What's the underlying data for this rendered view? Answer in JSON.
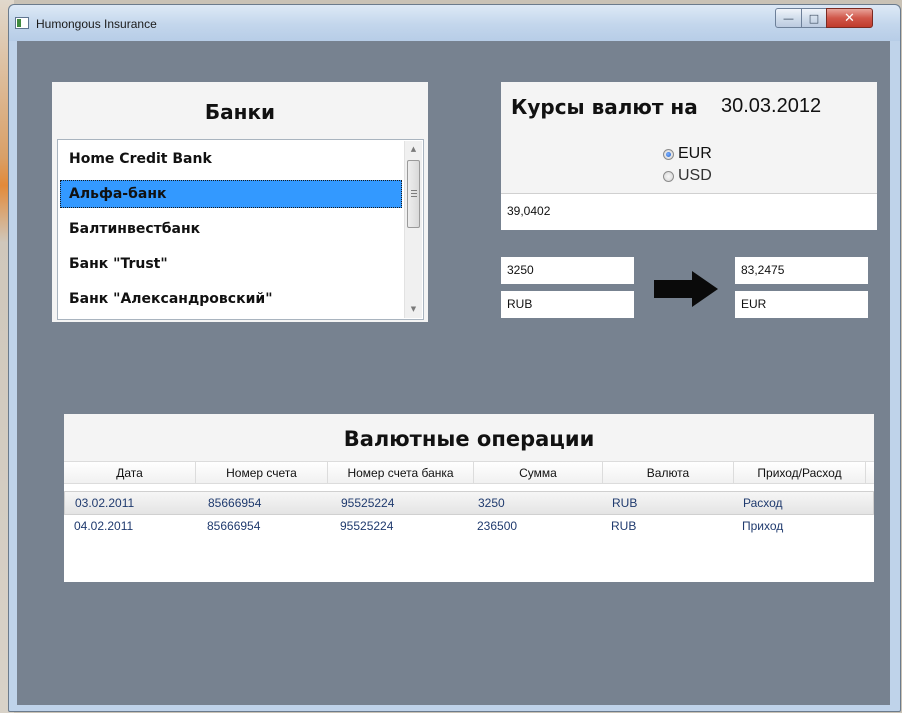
{
  "window": {
    "title": "Humongous Insurance",
    "controls": {
      "minimize": "—",
      "maximize": "□",
      "close": "✕"
    }
  },
  "banks": {
    "title": "Банки",
    "items": [
      {
        "label": "Home Credit Bank",
        "selected": false
      },
      {
        "label": "Альфа-банк",
        "selected": true
      },
      {
        "label": "Балтинвестбанк",
        "selected": false
      },
      {
        "label": "Банк \"Trust\"",
        "selected": false
      },
      {
        "label": "Банк \"Александровский\"",
        "selected": false
      }
    ]
  },
  "rates": {
    "title": "Курсы валют на",
    "date": "30.03.2012",
    "options": [
      {
        "label": "EUR",
        "checked": true
      },
      {
        "label": "USD",
        "checked": false
      }
    ],
    "rate_value": "39,0402"
  },
  "converter": {
    "amount": "3250",
    "from_currency": "RUB",
    "result": "83,2475",
    "to_currency": "EUR"
  },
  "operations": {
    "title": "Валютные операции",
    "columns": [
      "Дата",
      "Номер счета",
      "Номер счета банка",
      "Сумма",
      "Валюта",
      "Приход/Расход"
    ],
    "rows": [
      {
        "date": "03.02.2011",
        "account": "85666954",
        "bank_account": "95525224",
        "amount": "3250",
        "currency": "RUB",
        "direction": "Расход"
      },
      {
        "date": "04.02.2011",
        "account": "85666954",
        "bank_account": "95525224",
        "amount": "236500",
        "currency": "RUB",
        "direction": "Приход"
      }
    ]
  },
  "colors": {
    "client_background": "#778290",
    "selection": "#3399ff",
    "cell_text": "#1f3a6e"
  }
}
